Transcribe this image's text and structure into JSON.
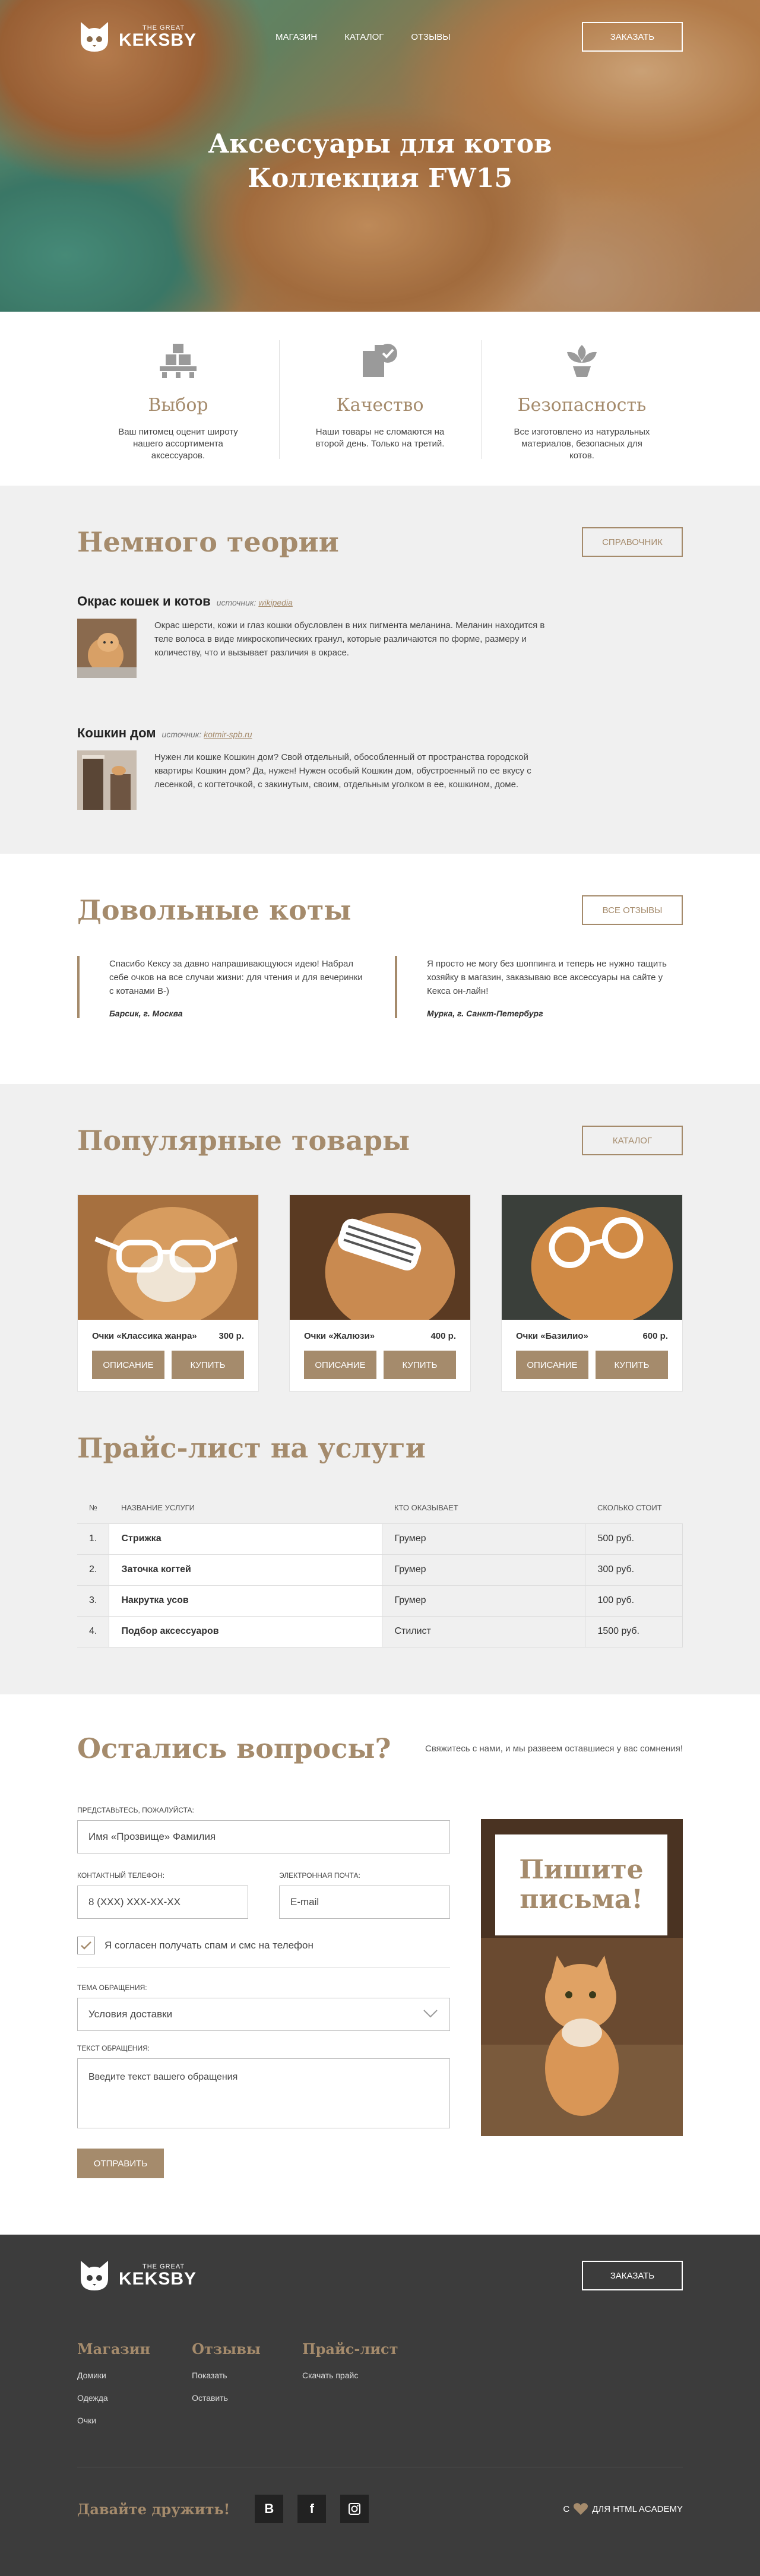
{
  "header": {
    "logo_small": "THE GREAT",
    "logo_big": "KEKSBY",
    "nav": [
      "МАГАЗИН",
      "КАТАЛОГ",
      "ОТЗЫВЫ"
    ],
    "order_button": "ЗАКАЗАТЬ"
  },
  "hero": {
    "title_line1": "Аксессуары для котов",
    "title_line2": "Коллекция FW15"
  },
  "features": [
    {
      "title": "Выбор",
      "text": "Ваш питомец оценит широту нашего ассортимента аксессуаров.",
      "icon": "boxes-icon"
    },
    {
      "title": "Качество",
      "text": "Наши товары не сломаются на второй день. Только на третий.",
      "icon": "quality-check-icon"
    },
    {
      "title": "Безопасность",
      "text": "Все изготовлено из натуральных материалов, безопасных для котов.",
      "icon": "leaf-icon"
    }
  ],
  "theory": {
    "title": "Немного теории",
    "button": "СПРАВОЧНИК",
    "articles": [
      {
        "title": "Окрас кошек и котов",
        "source_label": "источник:",
        "source_link": "wikipedia",
        "text": "Окрас шерсти, кожи и глаз кошки обусловлен в них пигмента меланина. Меланин находится в теле волоса в виде микроскопических гранул, которые различаются по форме, размеру и количеству, что и вызывает различия в окрасе."
      },
      {
        "title": "Кошкин дом",
        "source_label": "источник:",
        "source_link": "kotmir-spb.ru",
        "text": "Нужен ли кошке Кошкин дом? Свой отдельный, обособленный от пространства городской квартиры Кошкин дом? Да, нужен! Нужен особый Кошкин дом, обустроенный по ее вкусу с лесенкой, с когтеточкой, с закинутым, своим, отдельным уголком в ее, кошкином, доме."
      }
    ]
  },
  "reviews": {
    "title": "Довольные коты",
    "button": "ВСЕ ОТЗЫВЫ",
    "items": [
      {
        "text": "Спасибо Кексу за давно напрашивающуюся идею! Набрал себе очков на все случаи жизни: для чтения и для вечеринки с котанами B-)",
        "author": "Барсик, г. Москва"
      },
      {
        "text": "Я просто не могу без шоппинга и теперь не нужно тащить хозяйку в магазин, заказываю все аксессуары на сайте у Кекса он-лайн!",
        "author": "Мурка, г. Санкт-Петербург"
      }
    ]
  },
  "products": {
    "title": "Популярные товары",
    "button": "КАТАЛОГ",
    "desc_button": "ОПИСАНИЕ",
    "buy_button": "КУПИТЬ",
    "items": [
      {
        "name": "Очки «Классика жанра»",
        "price": "300 р."
      },
      {
        "name": "Очки «Жалюзи»",
        "price": "400 р."
      },
      {
        "name": "Очки «Базилио»",
        "price": "600 р."
      }
    ]
  },
  "pricelist": {
    "title": "Прайс-лист на услуги",
    "headers": [
      "№",
      "НАЗВАНИЕ УСЛУГИ",
      "КТО ОКАЗЫВАЕТ",
      "СКОЛЬКО СТОИТ"
    ],
    "rows": [
      [
        "1.",
        "Стрижка",
        "Грумер",
        "500 руб."
      ],
      [
        "2.",
        "Заточка когтей",
        "Грумер",
        "300 руб."
      ],
      [
        "3.",
        "Накрутка усов",
        "Грумер",
        "100 руб."
      ],
      [
        "4.",
        "Подбор аксессуаров",
        "Стилист",
        "1500 руб."
      ]
    ]
  },
  "contact": {
    "title": "Остались вопросы?",
    "subtitle": "Свяжитесь с нами, и мы развеем оставшиеся у вас сомнения!",
    "name_label": "ПРЕДСТАВЬТЕСЬ, ПОЖАЛУЙСТА:",
    "name_placeholder": "Имя «Прозвище» Фамилия",
    "phone_label": "КОНТАКТНЫЙ ТЕЛЕФОН:",
    "phone_placeholder": "8 (XXX) XXX-XX-XX",
    "email_label": "ЭЛЕКТРОННАЯ ПОЧТА:",
    "email_placeholder": "E-mail",
    "consent": "Я согласен получать спам и смс на телефон",
    "topic_label": "ТЕМА ОБРАЩЕНИЯ:",
    "topic_value": "Условия доставки",
    "message_label": "ТЕКСТ ОБРАЩЕНИЯ:",
    "message_placeholder": "Введите текст вашего обращения",
    "submit": "ОТПРАВИТЬ",
    "poster_line1": "Пишите",
    "poster_line2": "письма!"
  },
  "footer": {
    "logo_small": "THE GREAT",
    "logo_big": "KEKSBY",
    "order_button": "ЗАКАЗАТЬ",
    "cols": [
      {
        "title": "Магазин",
        "links": [
          "Домики",
          "Одежда",
          "Очки"
        ]
      },
      {
        "title": "Отзывы",
        "links": [
          "Показать",
          "Оставить"
        ]
      },
      {
        "title": "Прайс-лист",
        "links": [
          "Скачать прайс"
        ]
      }
    ],
    "friends": "Давайте дружить!",
    "socials": [
      "B",
      "f",
      "instagram-icon"
    ],
    "academy_prefix": "С",
    "academy_suffix": "ДЛЯ HTML ACADEMY"
  },
  "colors": {
    "accent": "#a58b6c",
    "footer": "#3c3c3c",
    "grey_section": "#f0f0f0"
  }
}
